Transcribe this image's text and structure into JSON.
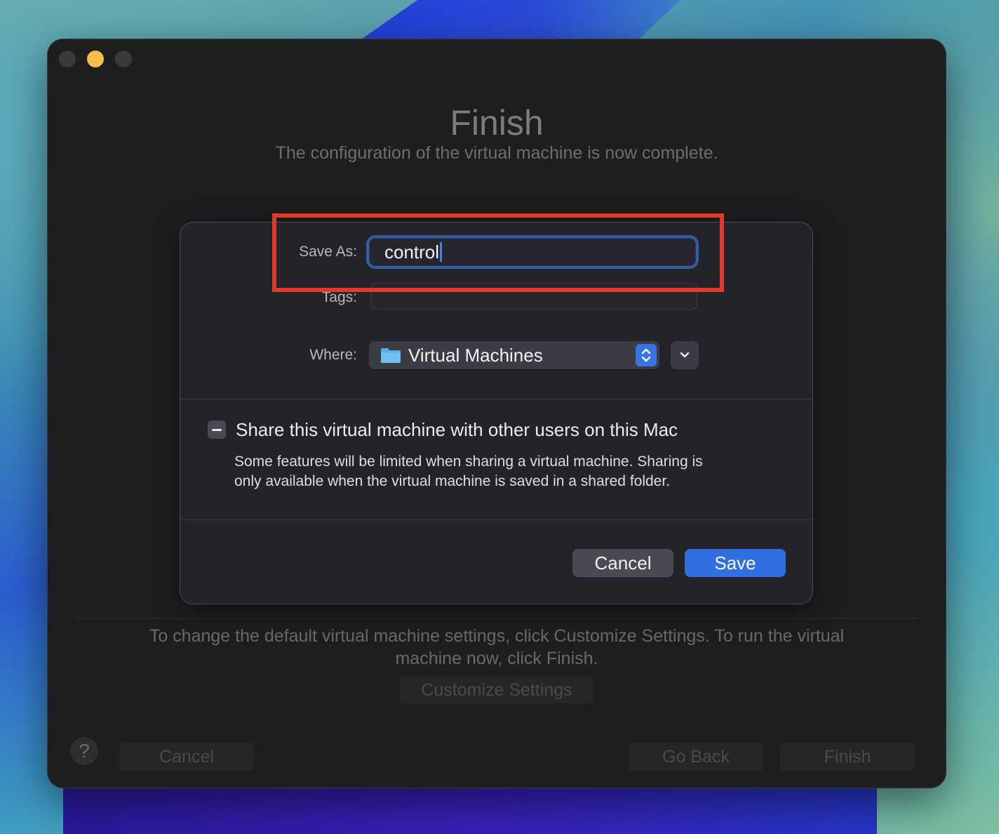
{
  "window": {
    "title": "Finish",
    "subtitle": "The configuration of the virtual machine is now complete.",
    "info_text": "To change the default virtual machine settings, click Customize Settings. To run the virtual machine now, click Finish.",
    "customize_label": "Customize Settings",
    "help_label": "?",
    "cancel_label": "Cancel",
    "go_back_label": "Go Back",
    "finish_label": "Finish"
  },
  "save_sheet": {
    "save_as_label": "Save As:",
    "save_as_value": "control",
    "tags_label": "Tags:",
    "tags_value": "",
    "where_label": "Where:",
    "where_value": "Virtual Machines",
    "where_icon": "folder-icon",
    "share_label": "Share this virtual machine with other users on this Mac",
    "share_state": "mixed",
    "share_desc": "Some features will be limited when sharing a virtual machine. Sharing is only available when the virtual machine is saved in a shared folder.",
    "cancel_label": "Cancel",
    "save_label": "Save"
  },
  "colors": {
    "accent": "#2f6fe0",
    "highlight": "#e03a2c",
    "minimize": "#f5bf4f"
  }
}
